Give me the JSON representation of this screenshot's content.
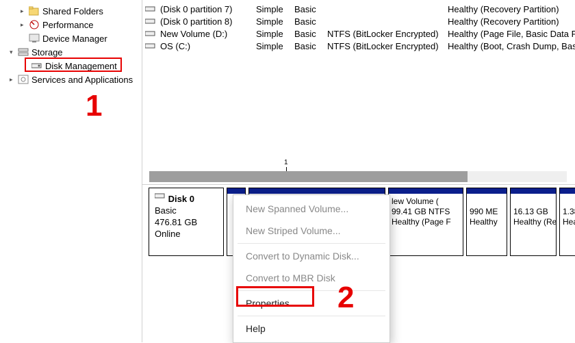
{
  "tree": {
    "shared_folders": "Shared Folders",
    "performance": "Performance",
    "device_manager": "Device Manager",
    "storage": "Storage",
    "disk_management": "Disk Management",
    "services_apps": "Services and Applications"
  },
  "volumes": [
    {
      "name": "(Disk 0 partition 7)",
      "layout": "Simple",
      "type": "Basic",
      "fs": "",
      "status": "Healthy (Recovery Partition)"
    },
    {
      "name": "(Disk 0 partition 8)",
      "layout": "Simple",
      "type": "Basic",
      "fs": "",
      "status": "Healthy (Recovery Partition)"
    },
    {
      "name": "New Volume (D:)",
      "layout": "Simple",
      "type": "Basic",
      "fs": "NTFS (BitLocker Encrypted)",
      "status": "Healthy (Page File, Basic Data Partiti"
    },
    {
      "name": "OS (C:)",
      "layout": "Simple",
      "type": "Basic",
      "fs": "NTFS (BitLocker Encrypted)",
      "status": "Healthy (Boot, Crash Dump, Basic Da"
    }
  ],
  "disk": {
    "title": "Disk 0",
    "type": "Basic",
    "size": "476.81 GB",
    "state": "Online"
  },
  "blocks": {
    "b1_l1": "lew Volume  (",
    "b1_l2": "99.41 GB NTFS",
    "b1_l3": "Healthy (Page F",
    "b2_l1": "990 ME",
    "b2_l2": "Healthy",
    "b3_l1": "16.13 GB",
    "b3_l2": "Healthy (Re",
    "b4_l1": "1.38",
    "b4_l2": "Heal"
  },
  "menu": {
    "new_spanned": "New Spanned Volume...",
    "new_striped": "New Striped Volume...",
    "convert_dyn": "Convert to Dynamic Disk...",
    "convert_mbr": "Convert to MBR Disk",
    "properties": "Properties",
    "help": "Help"
  },
  "scroll_tick": "1",
  "annotations": {
    "a1": "1",
    "a2": "2"
  }
}
